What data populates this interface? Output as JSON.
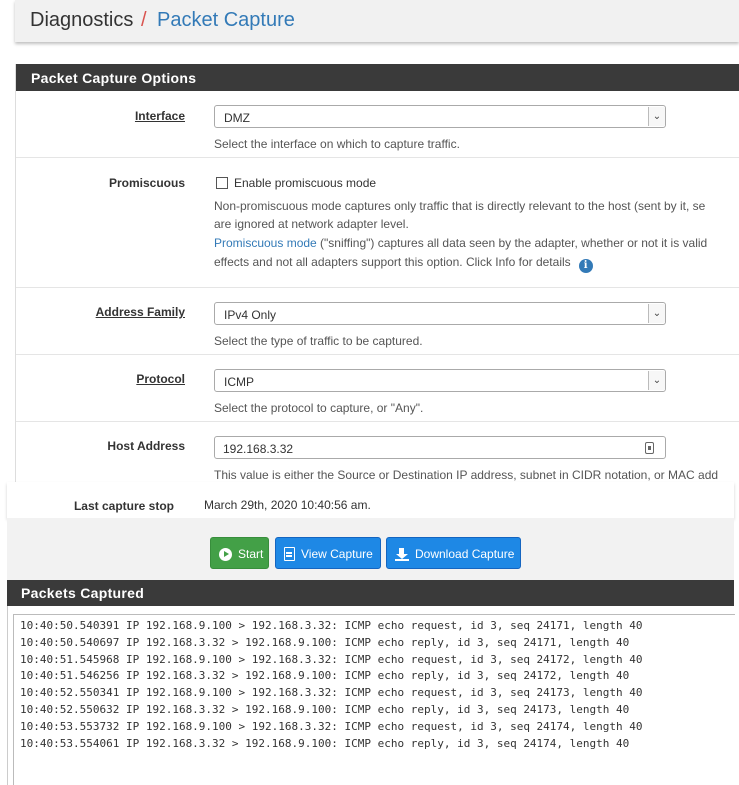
{
  "breadcrumb": {
    "section": "Diagnostics",
    "separator": "/",
    "page": "Packet Capture"
  },
  "options_panel": {
    "title": "Packet Capture Options",
    "interface": {
      "label": "Interface",
      "value": "DMZ",
      "help": "Select the interface on which to capture traffic."
    },
    "promiscuous": {
      "label": "Promiscuous",
      "checkbox_label": "Enable promiscuous mode",
      "checked": false,
      "help1": "Non-promiscuous mode captures only traffic that is directly relevant to the host (sent by it, se",
      "help2": "are ignored at network adapter level.",
      "link": "Promiscuous mode",
      "help3": " (\"sniffing\") captures all data seen by the adapter, whether or not it is valid",
      "help4": "effects and not all adapters support this option. Click Info for details",
      "info_icon": "info-icon"
    },
    "address_family": {
      "label": "Address Family",
      "value": "IPv4 Only",
      "help": "Select the type of traffic to be captured."
    },
    "protocol": {
      "label": "Protocol",
      "value": "ICMP",
      "help": "Select the protocol to capture, or \"Any\"."
    },
    "host_address": {
      "label": "Host Address",
      "value": "192.168.3.32",
      "help": "This value is either the Source or Destination IP address, subnet in CIDR notation, or MAC add"
    }
  },
  "last_capture": {
    "label": "Last capture stop",
    "value": "March 29th, 2020 10:40:56 am."
  },
  "buttons": {
    "start": "Start",
    "view": "View Capture",
    "download": "Download Capture"
  },
  "packets": {
    "title": "Packets Captured",
    "lines": [
      "10:40:50.540391 IP 192.168.9.100 > 192.168.3.32: ICMP echo request, id 3, seq 24171, length 40",
      "10:40:50.540697 IP 192.168.3.32 > 192.168.9.100: ICMP echo reply, id 3, seq 24171, length 40",
      "10:40:51.545968 IP 192.168.9.100 > 192.168.3.32: ICMP echo request, id 3, seq 24172, length 40",
      "10:40:51.546256 IP 192.168.3.32 > 192.168.9.100: ICMP echo reply, id 3, seq 24172, length 40",
      "10:40:52.550341 IP 192.168.9.100 > 192.168.3.32: ICMP echo request, id 3, seq 24173, length 40",
      "10:40:52.550632 IP 192.168.3.32 > 192.168.9.100: ICMP echo reply, id 3, seq 24173, length 40",
      "10:40:53.553732 IP 192.168.9.100 > 192.168.3.32: ICMP echo request, id 3, seq 24174, length 40",
      "10:40:53.554061 IP 192.168.3.32 > 192.168.9.100: ICMP echo reply, id 3, seq 24174, length 40"
    ]
  },
  "colors": {
    "accent": "#337ab7",
    "heading_bg": "#3a3a3a",
    "start_button": "#43a047",
    "action_button": "#1e88e5",
    "separator": "#d9534f"
  }
}
